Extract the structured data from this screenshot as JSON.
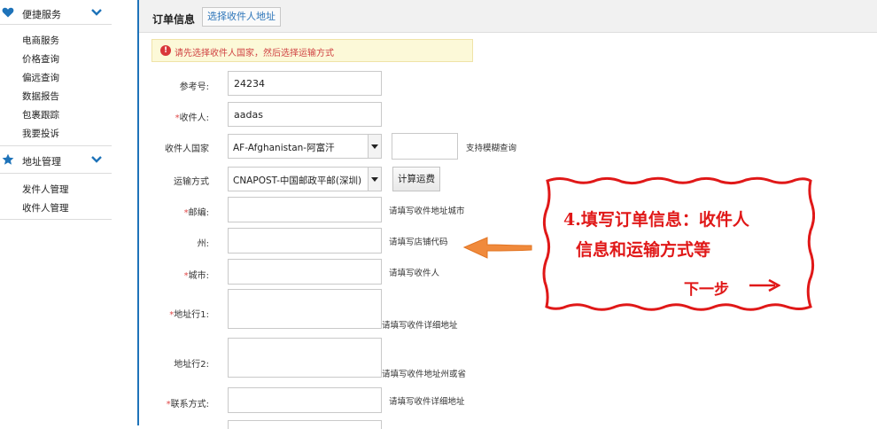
{
  "sidebar": {
    "groups": [
      {
        "title": "便捷服务",
        "items": [
          "电商服务",
          "价格查询",
          "偏远查询",
          "数据报告",
          "包裹跟踪",
          "我要投诉"
        ]
      },
      {
        "title": "地址管理",
        "items": [
          "发件人管理",
          "收件人管理"
        ]
      }
    ],
    "icons": [
      "heart-icon",
      "star-icon"
    ],
    "accent": "#1e73b9"
  },
  "header": {
    "title": "订单信息",
    "tab": "选择收件人地址"
  },
  "notice": {
    "text": "请先选择收件人国家，然后选择运输方式",
    "color": "#d04444"
  },
  "form": {
    "ref": {
      "label": "参考号:",
      "value": "24234"
    },
    "recipient": {
      "required": "*",
      "label": "收件人:",
      "value": "aadas"
    },
    "country": {
      "label": "收件人国家",
      "value": "AF-Afghanistan-阿富汗",
      "search_value": "",
      "search_hint": "支持模糊查询"
    },
    "shipping": {
      "label": "运输方式",
      "value": "CNAPOST-中国邮政平邮(深圳)",
      "calc_button": "计算运费"
    },
    "zip": {
      "required": "*",
      "label": "邮编:",
      "value": "",
      "hint": "请填写收件地址城市"
    },
    "state": {
      "label": "州:",
      "value": "",
      "hint": "请填写店铺代码"
    },
    "city": {
      "required": "*",
      "label": "城市:",
      "value": "",
      "hint": "请填写收件人"
    },
    "addr1": {
      "required": "*",
      "label": "地址行1:",
      "value": "",
      "hint": "请填写收件详细地址"
    },
    "addr2": {
      "label": "地址行2:",
      "value": "",
      "hint": "请填写收件地址州或省"
    },
    "contact": {
      "required": "*",
      "label": "联系方式:",
      "value": "",
      "hint": "请填写收件详细地址"
    }
  },
  "callout": {
    "line1": "4.填写订单信息：收件人",
    "line2": "信息和运输方式等",
    "next": "下一步",
    "color": "#e01818"
  }
}
